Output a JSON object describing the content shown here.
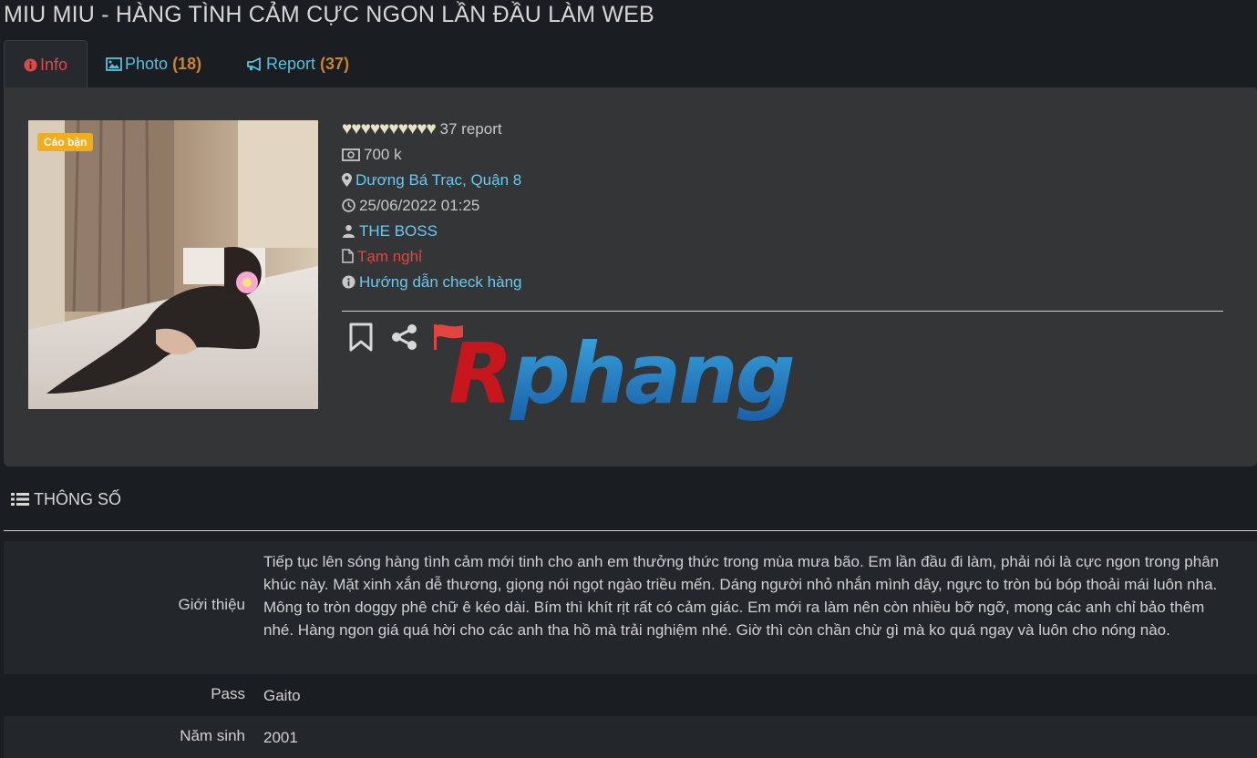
{
  "page": {
    "title": "MIU MIU - HÀNG TÌNH CẢM CỰC NGON LẦN ĐẦU LÀM WEB"
  },
  "tabs": [
    {
      "label": "Info",
      "icon": "info-circle-icon",
      "active": true
    },
    {
      "label": "Photo",
      "count": "(18)",
      "icon": "image-icon"
    },
    {
      "label": "Report",
      "count": "(37)",
      "icon": "megaphone-icon"
    }
  ],
  "listing": {
    "badge": "Cáo bận",
    "hearts": "♥♥♥♥♥♥♥♥♥♥",
    "report_count": "37 report",
    "price": "700 k",
    "location": "Dương Bá Trạc, Quận 8",
    "datetime": "25/06/2022 01:25",
    "owner": "THE BOSS",
    "status": "Tạm nghỉ",
    "guide_link": "Hướng dẫn check hàng",
    "watermark": "Rphang"
  },
  "specs": {
    "section_title": "THÔNG SỐ",
    "rows": [
      {
        "label": "Giới thiệu",
        "value": "Tiếp tục lên sóng hàng tình cảm mới tinh cho anh em thưởng thức trong mùa mưa bão. Em lần đầu đi làm, phải nói là cực ngon trong phân khúc này. Mặt xinh xắn dễ thương, giọng nói ngọt ngào triều mến. Dáng người nhỏ nhắn mình dây, ngực to tròn bú bóp thoải mái luôn nha. Mông to tròn doggy phê chữ ê kéo dài. Bím thì khít rịt rất có cảm giác. Em mới ra làm nên còn nhiều bỡ ngỡ, mong các anh chỉ bảo thêm nhé. Hàng ngon giá quá hời cho các anh tha hồ mà trải nghiệm nhé. Giờ thì còn chần chừ gì mà ko quá ngay và luôn cho nóng nào."
      },
      {
        "label": "Pass",
        "value": "Gaito"
      },
      {
        "label": "Năm sinh",
        "value": "2001"
      }
    ]
  },
  "colors": {
    "background": "#1a1d21",
    "panel": "#343536",
    "link_blue": "#6cc8ee",
    "status_red": "#e2443f",
    "count_orange": "#c9852b",
    "badge_yellow": "#f0ad1e"
  }
}
